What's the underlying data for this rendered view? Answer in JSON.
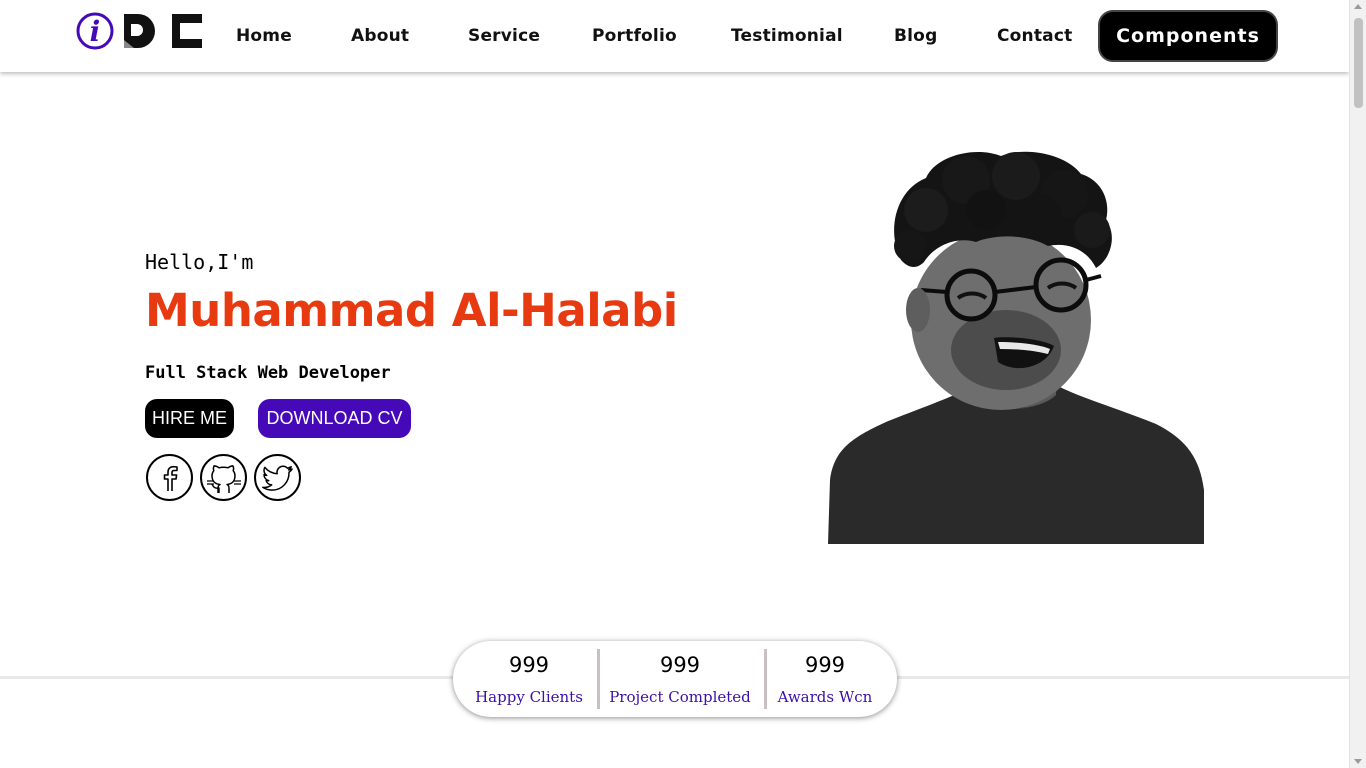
{
  "logo": {
    "text_i": "i",
    "text_dc": "DC"
  },
  "nav": {
    "items": [
      {
        "label": "Home"
      },
      {
        "label": "About"
      },
      {
        "label": "Service"
      },
      {
        "label": "Portfolio"
      },
      {
        "label": "Testimonial"
      },
      {
        "label": "Blog"
      },
      {
        "label": "Contact"
      }
    ],
    "components_label": "Components"
  },
  "hero": {
    "greeting": "Hello,I'm",
    "name": "Muhammad Al-Halabi",
    "role": "Full Stack Web Developer",
    "hire_label": "HIRE ME",
    "cv_label": "DOWNLOAD CV"
  },
  "social": {
    "icons": [
      "facebook-icon",
      "github-icon",
      "twitter-icon"
    ]
  },
  "stats": [
    {
      "value": "999",
      "label": "Happy Clients"
    },
    {
      "value": "999",
      "label": "Project Completed"
    },
    {
      "value": "999",
      "label": "Awards Wcn"
    }
  ],
  "colors": {
    "accent_purple": "#4509b8",
    "name_orange": "#e83a10",
    "stat_label": "#3c0fa8"
  }
}
